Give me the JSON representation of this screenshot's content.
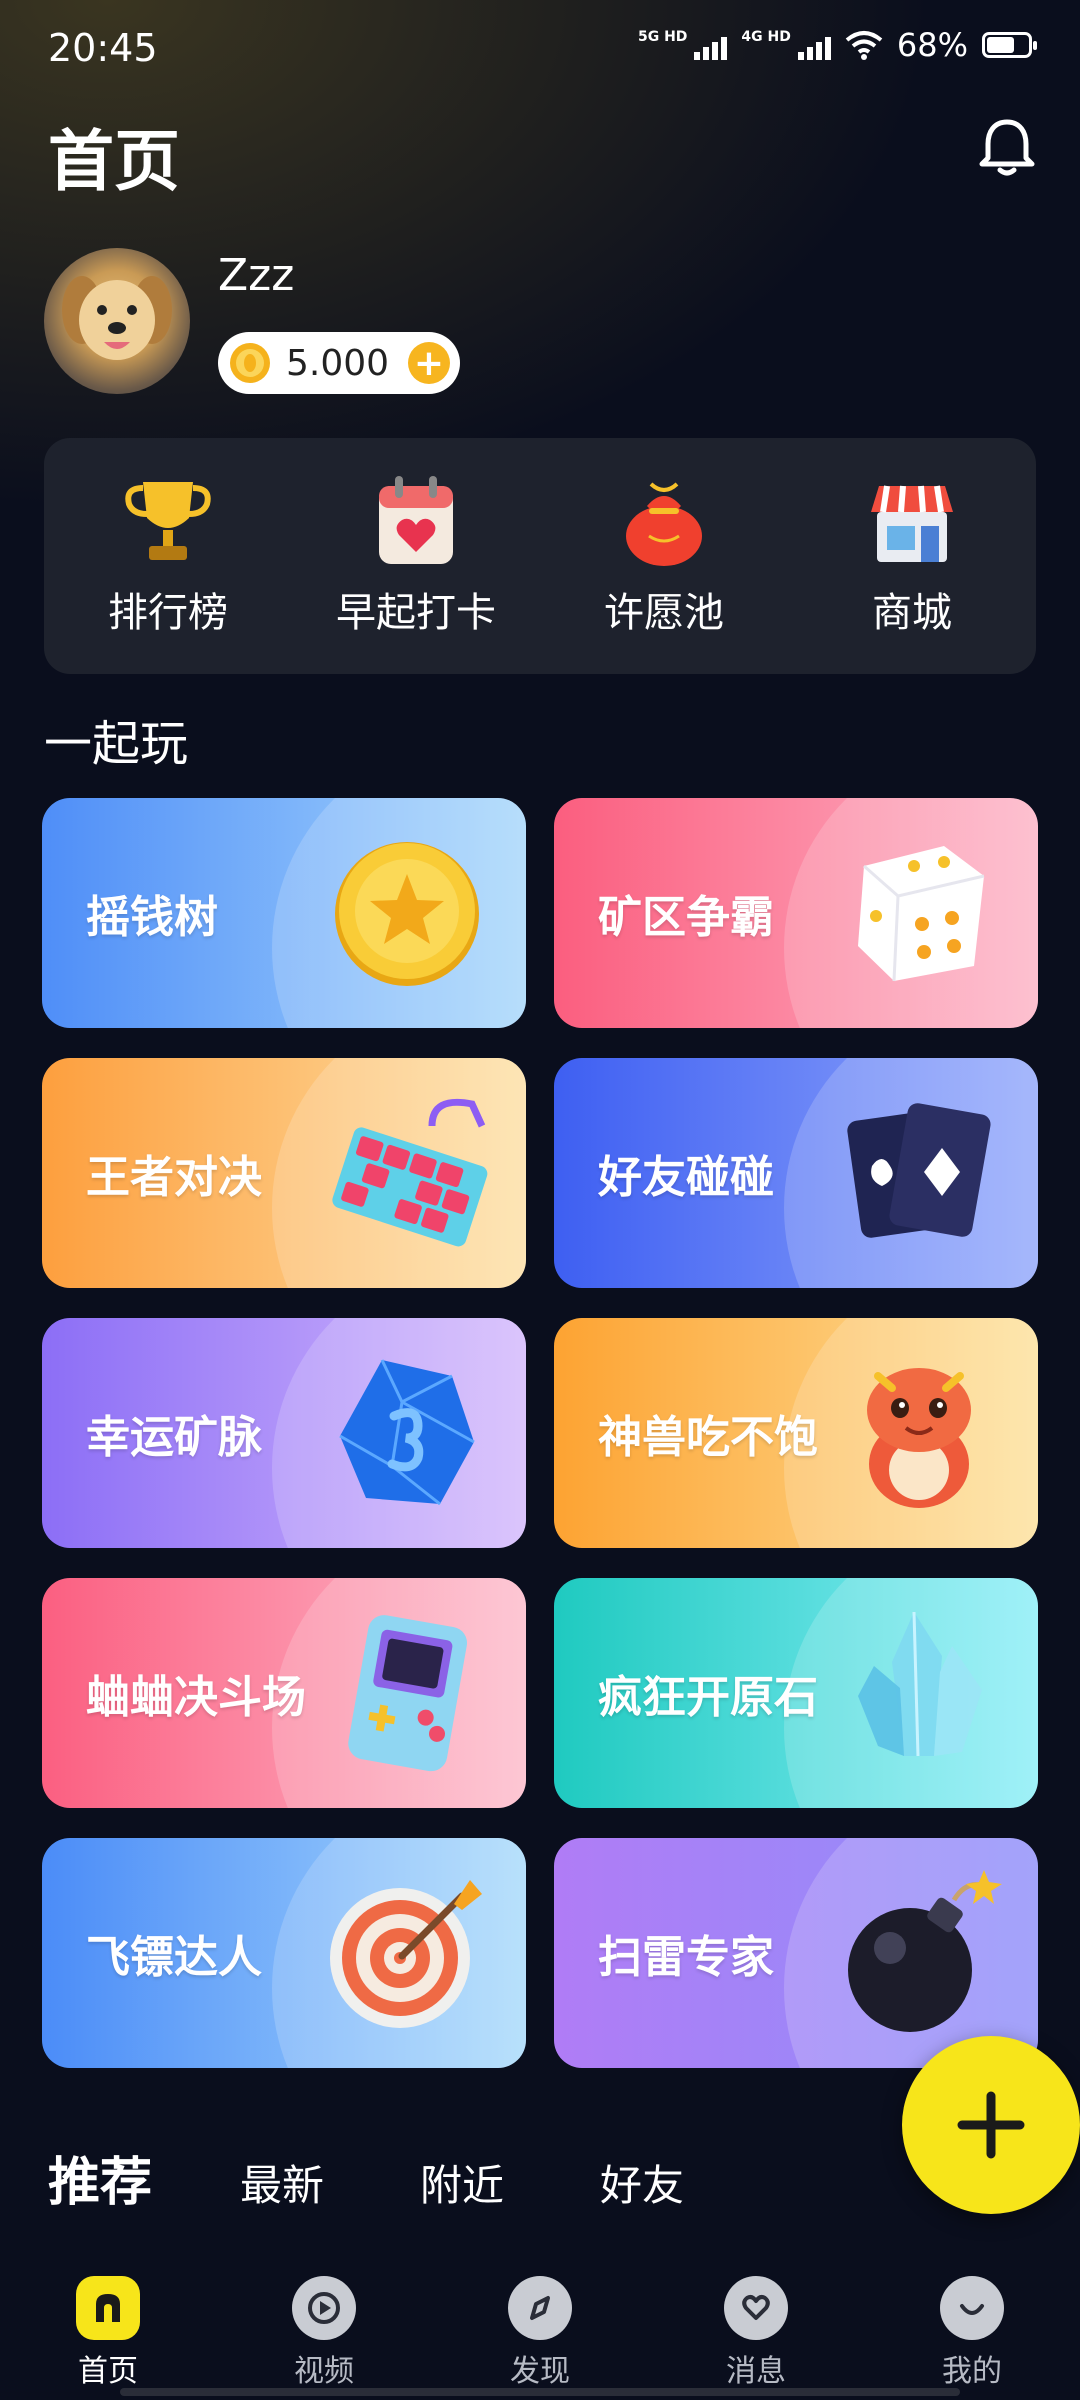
{
  "status_bar": {
    "time": "20:45",
    "net1": "5G HD",
    "net2": "4G HD",
    "battery": "68%",
    "battery_level": 0.68
  },
  "header": {
    "title": "首页"
  },
  "profile": {
    "username": "Zzz",
    "coins": "5.000"
  },
  "quick_actions": [
    {
      "label": "排行榜",
      "icon": "trophy-icon"
    },
    {
      "label": "早起打卡",
      "icon": "calendar-heart-icon"
    },
    {
      "label": "许愿池",
      "icon": "lucky-bag-icon"
    },
    {
      "label": "商城",
      "icon": "shop-icon"
    }
  ],
  "section_title": "一起玩",
  "games": [
    {
      "label": "摇钱树",
      "icon": "gold-coin-icon",
      "color_from": "#4f8ef8",
      "color_to": "#a7d7fb"
    },
    {
      "label": "矿区争霸",
      "icon": "dice-icon",
      "color_from": "#fb5e7f",
      "color_to": "#fdb3c6"
    },
    {
      "label": "王者对决",
      "icon": "keyboard-icon",
      "color_from": "#fd9f3e",
      "color_to": "#fde0a6"
    },
    {
      "label": "好友碰碰",
      "icon": "cards-icon",
      "color_from": "#3e5ff2",
      "color_to": "#92a8fb"
    },
    {
      "label": "幸运矿脉",
      "icon": "gem-icon",
      "color_from": "#8c6ef6",
      "color_to": "#d3b8fc"
    },
    {
      "label": "神兽吃不饱",
      "icon": "dragon-icon",
      "color_from": "#fda332",
      "color_to": "#fde19c"
    },
    {
      "label": "蛐蛐决斗场",
      "icon": "gameboy-icon",
      "color_from": "#fb5f81",
      "color_to": "#fdbbcb"
    },
    {
      "label": "疯狂开原石",
      "icon": "crystal-icon",
      "color_from": "#1fcac0",
      "color_to": "#8beef7"
    },
    {
      "label": "飞镖达人",
      "icon": "dart-target-icon",
      "color_from": "#4b8cf8",
      "color_to": "#a9dafb"
    },
    {
      "label": "扫雷专家",
      "icon": "bomb-icon",
      "color_from": "#b07cf6",
      "color_to": "#8f8ff9"
    }
  ],
  "feed_tabs": [
    "推荐",
    "最新",
    "附近",
    "好友"
  ],
  "bottom_nav": [
    {
      "label": "首页",
      "icon": "home-icon",
      "active": true
    },
    {
      "label": "视频",
      "icon": "play-icon",
      "active": false
    },
    {
      "label": "发现",
      "icon": "compass-icon",
      "active": false
    },
    {
      "label": "消息",
      "icon": "heart-chat-icon",
      "active": false
    },
    {
      "label": "我的",
      "icon": "smile-icon",
      "active": false
    }
  ]
}
